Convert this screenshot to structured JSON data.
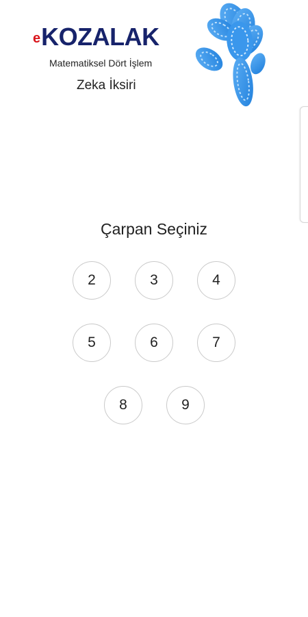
{
  "header": {
    "logo_prefix": "e",
    "logo_name": "KOZALAK",
    "subtitle": "Matematiksel Dört İşlem",
    "tagline": "Zeka İksiri",
    "brand_color_red": "#d9141b",
    "brand_color_navy": "#17236b",
    "cone_color": "#2f8ee8",
    "cone_icon": "pine-cone-icon"
  },
  "main": {
    "title": "Çarpan Seçiniz",
    "buttons": [
      {
        "label": "2"
      },
      {
        "label": "3"
      },
      {
        "label": "4"
      },
      {
        "label": "5"
      },
      {
        "label": "6"
      },
      {
        "label": "7"
      },
      {
        "label": "8"
      },
      {
        "label": "9"
      }
    ]
  }
}
